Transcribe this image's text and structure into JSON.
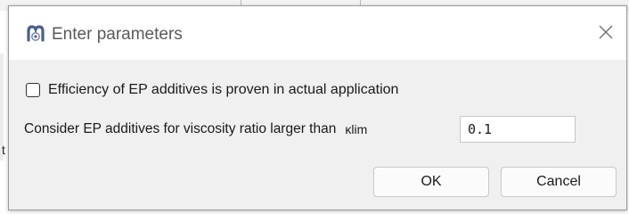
{
  "dialog": {
    "title": "Enter parameters",
    "icon": "app-logo-icon",
    "close_icon": "close-icon"
  },
  "option": {
    "label": "Efficiency of EP additives is proven in actual application",
    "checked": false
  },
  "parameter": {
    "label": "Consider EP additives for viscosity ratio larger than",
    "symbol": "κ",
    "symbol_sub": "lim",
    "value": "0.1"
  },
  "buttons": {
    "ok_label": "OK",
    "cancel_label": "Cancel"
  },
  "background": {
    "glyph": "t"
  },
  "colors": {
    "dialog_bg": "#f0f0f0",
    "titlebar_bg": "#ffffff",
    "icon_blue": "#4a5f8f"
  }
}
